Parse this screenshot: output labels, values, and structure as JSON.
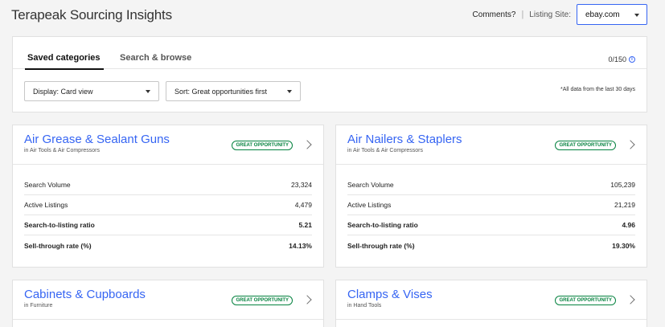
{
  "header": {
    "title": "Terapeak Sourcing Insights",
    "comments_label": "Comments?",
    "separator": "|",
    "listing_site_label": "Listing Site:",
    "listing_site_value": "ebay.com"
  },
  "tabs": [
    {
      "label": "Saved categories",
      "active": true
    },
    {
      "label": "Search & browse",
      "active": false
    }
  ],
  "counter": "0/150",
  "filters": {
    "display": "Display: Card view",
    "sort": "Sort: Great opportunities first",
    "note": "*All data from the last 30 days"
  },
  "cards": [
    {
      "title": "Air Grease & Sealant Guns",
      "subtitle": "in Air Tools & Air Compressors",
      "badge": "GREAT OPPORTUNITY",
      "metrics": [
        {
          "label": "Search Volume",
          "value": "23,324"
        },
        {
          "label": "Active Listings",
          "value": "4,479"
        },
        {
          "label": "Search-to-listing ratio",
          "value": "5.21"
        },
        {
          "label": "Sell-through rate (%)",
          "value": "14.13%"
        }
      ]
    },
    {
      "title": "Air Nailers & Staplers",
      "subtitle": "in Air Tools & Air Compressors",
      "badge": "GREAT OPPORTUNITY",
      "metrics": [
        {
          "label": "Search Volume",
          "value": "105,239"
        },
        {
          "label": "Active Listings",
          "value": "21,219"
        },
        {
          "label": "Search-to-listing ratio",
          "value": "4.96"
        },
        {
          "label": "Sell-through rate (%)",
          "value": "19.30%"
        }
      ]
    },
    {
      "title": "Cabinets & Cupboards",
      "subtitle": "in Furniture",
      "badge": "GREAT OPPORTUNITY"
    },
    {
      "title": "Clamps & Vises",
      "subtitle": "in Hand Tools",
      "badge": "GREAT OPPORTUNITY"
    }
  ],
  "colors": {
    "link_blue": "#3665f3",
    "opportunity_green": "#05823f"
  }
}
